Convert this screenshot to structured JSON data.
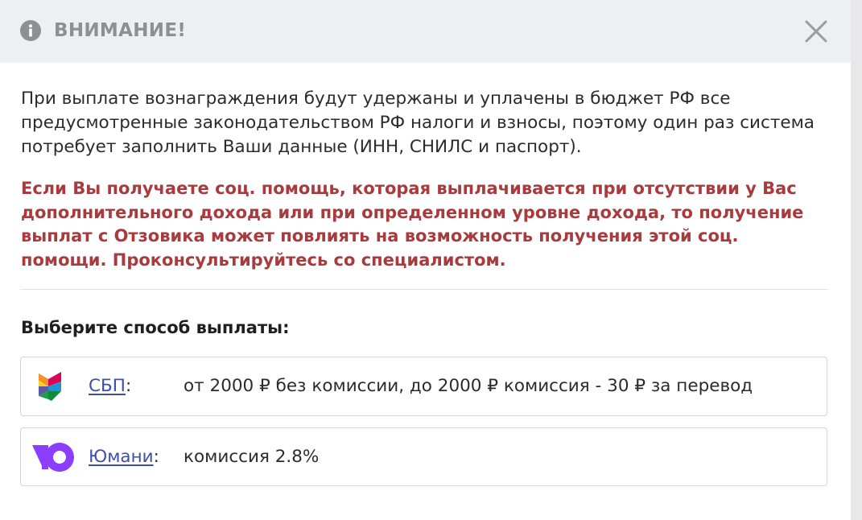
{
  "header": {
    "title": "ВНИМАНИЕ!",
    "info_icon": "info-circle-icon",
    "close_icon": "close-icon"
  },
  "notice": {
    "text": "При выплате вознаграждения будут удержаны и уплачены в бюджет РФ все предусмотренные законодательством РФ налоги и взносы, поэтому один раз система потребует заполнить Ваши данные (ИНН, СНИЛС и паспорт)."
  },
  "warning": {
    "text": "Если Вы получаете соц. помощь, которая выплачивается при отсутствии у Вас дополнительного дохода или при определенном уровне дохода, то получение выплат с Отзовика может повлиять на возможность получения этой соц. помощи. Проконсультируйтесь со специалистом.",
    "color": "#a83b3d"
  },
  "payment": {
    "section_title": "Выберите способ выплаты:",
    "options": [
      {
        "name": "СБП",
        "separator": ":",
        "description": "от 2000 ₽ без комиссии, до 2000 ₽ комиссия - 30 ₽ за перевод",
        "icon": "sbp-logo-icon"
      },
      {
        "name": "Юмани",
        "separator": ":",
        "description": "комиссия 2.8%",
        "icon": "yumoney-logo-icon"
      }
    ]
  },
  "colors": {
    "header_bg": "#eeeff1",
    "link": "#3b4fb0",
    "yumoney_purple": "#8b3ffd"
  }
}
